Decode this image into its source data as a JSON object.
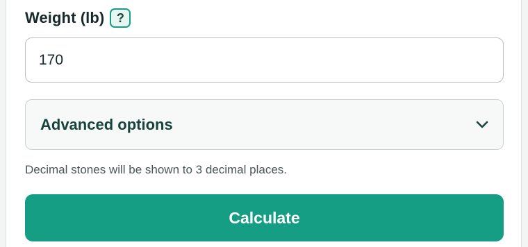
{
  "weight": {
    "label": "Weight (lb)",
    "help_label": "?",
    "value": "170"
  },
  "advanced": {
    "label": "Advanced options",
    "icon": "chevron-down-icon"
  },
  "hint": "Decimal stones will be shown to 3 decimal places.",
  "calculate_label": "Calculate",
  "colors": {
    "accent": "#169e84",
    "heading": "#17433c",
    "text": "#17292b"
  }
}
